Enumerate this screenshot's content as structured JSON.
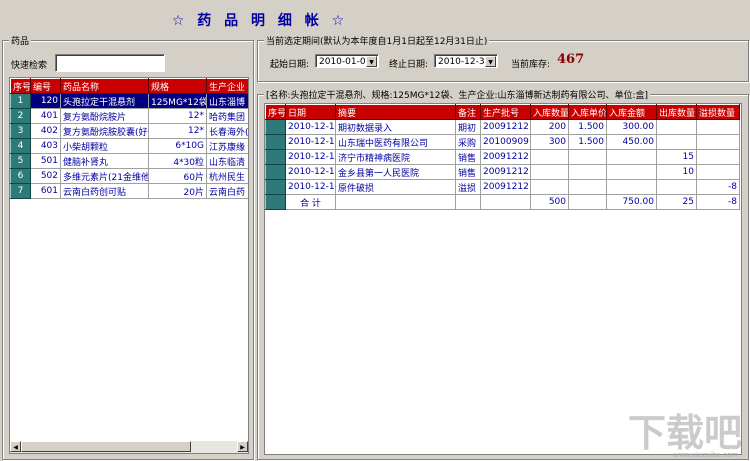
{
  "title": "☆ 药 品 明 细 帐 ☆",
  "left_panel": {
    "legend": "药品",
    "search_label": "快速检索",
    "search_value": "",
    "columns": [
      "序号",
      "编号",
      "药品名称",
      "规格",
      "生产企业"
    ],
    "rows": [
      {
        "seq": "1",
        "code": "120",
        "name": "头孢拉定干混悬剂",
        "spec": "125MG*12袋",
        "maker": "山东淄博"
      },
      {
        "seq": "2",
        "code": "401",
        "name": "复方氨酚烷胺片",
        "spec": "12*",
        "maker": "哈药集团"
      },
      {
        "seq": "3",
        "code": "402",
        "name": "复方氨酚烷胺胶囊(好",
        "spec": "12*",
        "maker": "长春海外("
      },
      {
        "seq": "4",
        "code": "403",
        "name": "小柴胡颗粒",
        "spec": "6*10G",
        "maker": "江苏康缘"
      },
      {
        "seq": "5",
        "code": "501",
        "name": "健脑补肾丸",
        "spec": "4*30粒",
        "maker": "山东临清"
      },
      {
        "seq": "6",
        "code": "502",
        "name": "多维元素片(21金维他",
        "spec": "60片",
        "maker": "杭州民生"
      },
      {
        "seq": "7",
        "code": "601",
        "name": "云南白药创可贴",
        "spec": "20片",
        "maker": "云南白药"
      }
    ]
  },
  "period": {
    "legend": "当前选定期间(默认为本年度自1月1日起至12月31日止)",
    "start_label": "起始日期:",
    "start_value": "2010-01-01",
    "end_label": "终止日期:",
    "end_value": "2010-12-31",
    "stock_label": "当前库存:",
    "stock_value": "467"
  },
  "detail": {
    "legend": "[名称:头孢拉定干混悬剂、规格:125MG*12袋、生产企业:山东淄博新达制药有限公司、单位:盒]",
    "columns": [
      "序号",
      "日期",
      "摘要",
      "备注",
      "生产批号",
      "入库数量",
      "入库单价",
      "入库金额",
      "出库数量",
      "溢损数量"
    ],
    "rows": [
      {
        "seq": "1",
        "date": "2010-12-16",
        "summary": "期初数据录入",
        "note": "期初",
        "batch": "20091212",
        "in_qty": "200",
        "in_price": "1.500",
        "in_amt": "300.00",
        "out_qty": "",
        "loss_qty": ""
      },
      {
        "seq": "2",
        "date": "2010-12-16",
        "summary": "山东瑞中医药有限公司",
        "note": "采购",
        "batch": "20100909",
        "in_qty": "300",
        "in_price": "1.500",
        "in_amt": "450.00",
        "out_qty": "",
        "loss_qty": ""
      },
      {
        "seq": "3",
        "date": "2010-12-16",
        "summary": "济宁市精神病医院",
        "note": "销售",
        "batch": "20091212",
        "in_qty": "",
        "in_price": "",
        "in_amt": "",
        "out_qty": "15",
        "loss_qty": ""
      },
      {
        "seq": "4",
        "date": "2010-12-16",
        "summary": "金乡县第一人民医院",
        "note": "销售",
        "batch": "20091212",
        "in_qty": "",
        "in_price": "",
        "in_amt": "",
        "out_qty": "10",
        "loss_qty": ""
      },
      {
        "seq": "5",
        "date": "2010-12-16",
        "summary": "原件破损",
        "note": "溢损",
        "batch": "20091212",
        "in_qty": "",
        "in_price": "",
        "in_amt": "",
        "out_qty": "",
        "loss_qty": "-8"
      }
    ],
    "total": {
      "label": "合    计",
      "in_qty": "500",
      "in_amt": "750.00",
      "out_qty": "25",
      "loss_qty": "-8"
    }
  },
  "watermark": {
    "text": "下载吧",
    "sub": "www.xiazaiba.com"
  }
}
